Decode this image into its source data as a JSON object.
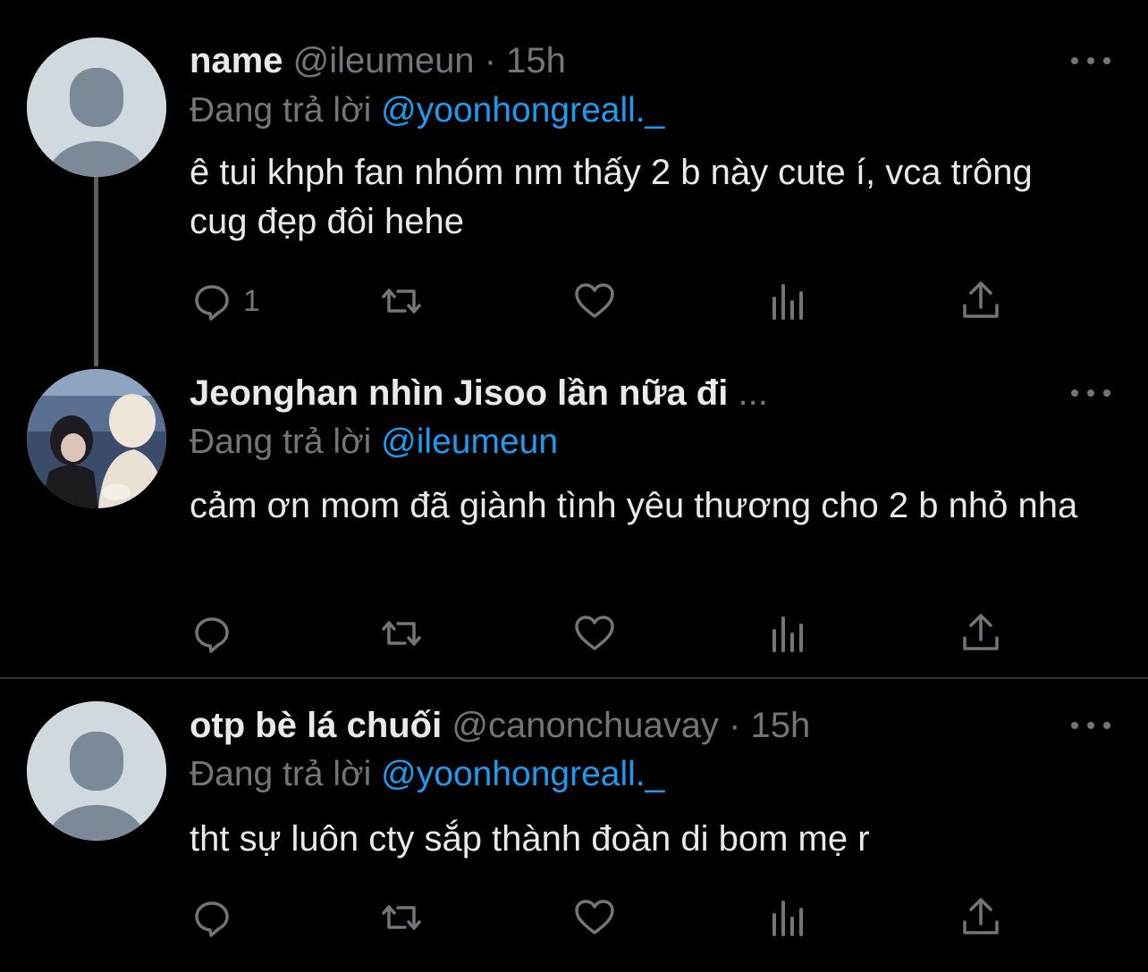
{
  "tweets": [
    {
      "name": "name",
      "handle": "@ileumeun",
      "separator": "·",
      "time": "15h",
      "replying_prefix": "Đang trả lời",
      "replying_to": "@yoonhongreall._",
      "text": "ê tui khph fan nhóm nm thấy 2 b này cute í, vca trông cug đẹp đôi hehe",
      "reply_count": "1",
      "avatar": "default-avatar"
    },
    {
      "name": "Jeonghan nhìn Jisoo lần nữa đi",
      "name_ellipsis": "...",
      "replying_prefix": "Đang trả lời",
      "replying_to": "@ileumeun",
      "text": "cảm ơn mom đã giành tình yêu thương cho 2 b nhỏ nha",
      "reply_count": "",
      "avatar": "photo-avatar"
    },
    {
      "name": "otp bè lá chuối",
      "handle": "@canonchuavay",
      "separator": "·",
      "time": "15h",
      "replying_prefix": "Đang trả lời",
      "replying_to": "@yoonhongreall._",
      "text": "tht sự luôn cty sắp thành đoàn di bom mẹ r",
      "reply_count": "",
      "avatar": "default-avatar"
    }
  ],
  "icons": [
    "reply-icon",
    "retweet-icon",
    "like-icon",
    "views-icon",
    "share-icon",
    "more-icon"
  ],
  "colors": {
    "background": "#000000",
    "text": "#e7e9ea",
    "secondary": "#71767b",
    "mention": "#1d9bf0"
  }
}
